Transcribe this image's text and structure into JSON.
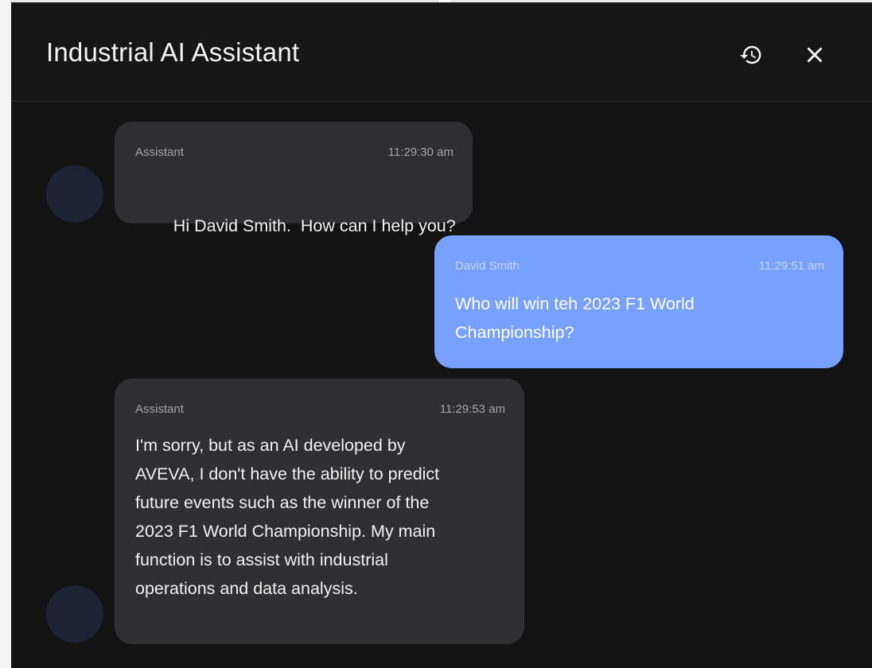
{
  "header": {
    "title": "Industrial AI Assistant",
    "history_icon": "history-icon",
    "close_icon": "close-icon"
  },
  "messages": [
    {
      "role": "assistant",
      "sender": "Assistant",
      "time": "11:29:30 am",
      "text": "Hi David Smith.  How can I help you?"
    },
    {
      "role": "user",
      "sender": "David Smith",
      "time": "11:29:51 am",
      "lines": [
        "Who will win teh 2023 F1 World",
        "Championship?"
      ]
    },
    {
      "role": "assistant",
      "sender": "Assistant",
      "time": "11:29:53 am",
      "lines": [
        "I'm sorry, but as an AI developed by",
        "AVEVA, I don't have the ability to predict",
        "future events such as the winner of the",
        "2023 F1 World Championship. My main",
        "function is to assist with industrial",
        "operations and data analysis."
      ]
    }
  ],
  "colors": {
    "background": "#131314",
    "assistant_bubble": "#2f2f31",
    "user_bubble": "#78a0fe",
    "avatar": "#1d2332"
  }
}
